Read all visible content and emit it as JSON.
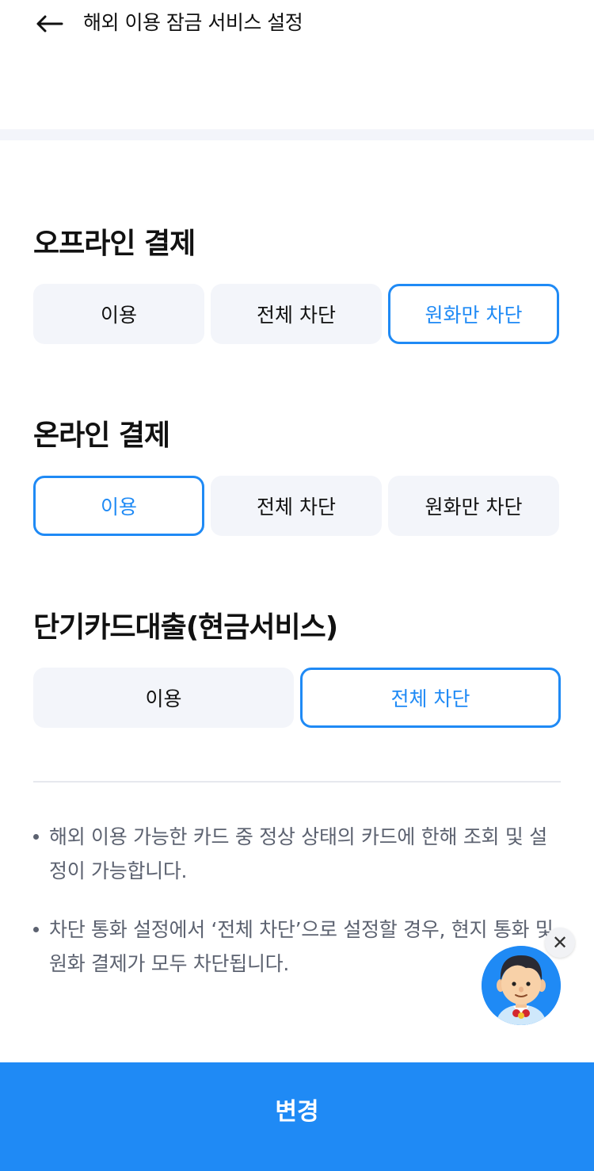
{
  "header": {
    "title": "해외 이용 잠금 서비스 설정",
    "back_icon": "arrow-left-icon"
  },
  "sections": [
    {
      "title": "오프라인 결제",
      "options": [
        "이용",
        "전체 차단",
        "원화만 차단"
      ],
      "selected": "원화만 차단"
    },
    {
      "title": "온라인 결제",
      "options": [
        "이용",
        "전체 차단",
        "원화만 차단"
      ],
      "selected": "이용"
    },
    {
      "title": "단기카드대출(현금서비스)",
      "options": [
        "이용",
        "전체 차단"
      ],
      "selected": "전체 차단"
    }
  ],
  "notes": [
    "해외 이용 가능한 카드 중 정상 상태의 카드에 한해 조회 및 설정이 가능합니다.",
    "차단 통화 설정에서 ‘전체 차단’으로 설정할 경우, 현지 통화 및 원화 결제가 모두 차단됩니다."
  ],
  "chatbot": {
    "icon": "chatbot-character-icon",
    "close_label": "✕"
  },
  "footer": {
    "submit_label": "변경"
  },
  "colors": {
    "accent": "#1f8af5",
    "option_bg": "#f3f5fa",
    "note_text": "#5c6270"
  }
}
